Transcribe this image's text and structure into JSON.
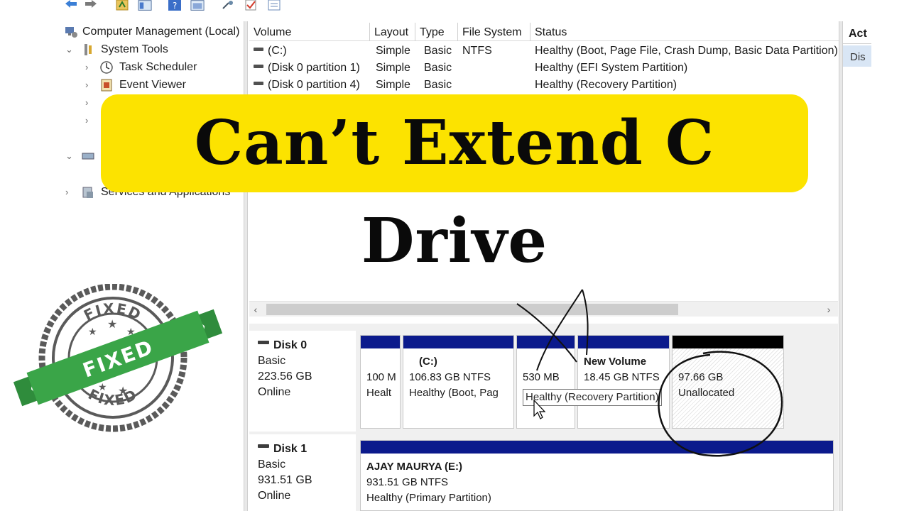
{
  "tree": {
    "root": "Computer Management (Local)",
    "system_tools": "System Tools",
    "task_scheduler": "Task Scheduler",
    "event_viewer": "Event Viewer",
    "services": "Services and Applications"
  },
  "volume_list": {
    "columns": [
      "Volume",
      "Layout",
      "Type",
      "File System",
      "Status"
    ],
    "rows": [
      {
        "volume": "(C:)",
        "layout": "Simple",
        "type": "Basic",
        "fs": "NTFS",
        "status": "Healthy (Boot, Page File, Crash Dump, Basic Data Partition)"
      },
      {
        "volume": "(Disk 0 partition 1)",
        "layout": "Simple",
        "type": "Basic",
        "fs": "",
        "status": "Healthy (EFI System Partition)"
      },
      {
        "volume": "(Disk 0 partition 4)",
        "layout": "Simple",
        "type": "Basic",
        "fs": "",
        "status": "Healthy (Recovery Partition)"
      }
    ]
  },
  "disks": [
    {
      "name": "Disk 0",
      "type": "Basic",
      "size": "223.56 GB",
      "state": "Online",
      "partitions": [
        {
          "title": "",
          "line1": "100 M",
          "line2": "Healt"
        },
        {
          "title": "(C:)",
          "line1": "106.83 GB NTFS",
          "line2": "Healthy (Boot, Pag"
        },
        {
          "title": "",
          "line1": "530 MB",
          "line2": ""
        },
        {
          "title": "New Volume",
          "line1": "18.45 GB NTFS",
          "line2": ""
        },
        {
          "title": "",
          "line1": "97.66 GB",
          "line2": "Unallocated"
        }
      ]
    },
    {
      "name": "Disk 1",
      "type": "Basic",
      "size": "931.51 GB",
      "state": "Online",
      "partitions": [
        {
          "title": "AJAY MAURYA  (E:)",
          "line1": "931.51 GB NTFS",
          "line2": "Healthy (Primary Partition)"
        }
      ]
    }
  ],
  "tooltip": "Healthy (Recovery Partition)",
  "actions": {
    "header": "Act",
    "item": "Dis"
  },
  "banner": {
    "text": "Can’t Extend C Drive"
  },
  "stamp": {
    "top": "FIXED",
    "ribbon": "FIXED",
    "bottom": "FIXED"
  },
  "colors": {
    "banner_bg": "#fce300",
    "partition_bar": "#0b1a8c",
    "stamp_green": "#3aa548",
    "stamp_gray": "#5a5a5a"
  },
  "icons": [
    "back-arrow-icon",
    "forward-arrow-icon",
    "folder-up-icon",
    "console-tree-icon",
    "help-icon",
    "properties-icon",
    "checkmark-icon",
    "list-icon"
  ]
}
